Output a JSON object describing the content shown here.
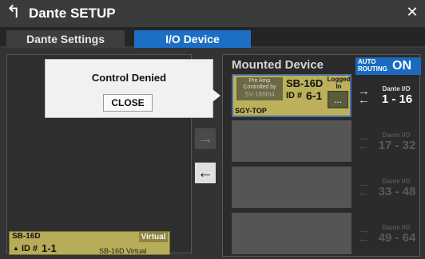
{
  "header": {
    "title": "Dante SETUP"
  },
  "tabs": [
    {
      "label": "Dante Settings"
    },
    {
      "label": "I/O Device"
    }
  ],
  "virtual_device": {
    "model": "SB-16D",
    "tag": "Virtual",
    "id_label": "ID #",
    "id": "1-1",
    "model_desc": "SB-16D Virtual"
  },
  "popup": {
    "message": "Control Denied",
    "button": "CLOSE"
  },
  "mounted": {
    "title": "Mounted Device",
    "auto_routing": {
      "label": "AUTO ROUTING",
      "state": "ON"
    },
    "device": {
      "preamp_line1": "Pre Amp",
      "preamp_line2": "Controlled by",
      "preamp_id": "SV-186fd4",
      "model": "SB-16D",
      "id_label": "ID #",
      "id": "6-1",
      "logged": "Logged In",
      "more": "...",
      "name": "SGY-TOP"
    },
    "slots": [
      {
        "dio_label": "Dante I/O",
        "range": "1 - 16",
        "active": true
      },
      {
        "dio_label": "Dante I/O",
        "range": "17 - 32",
        "active": false
      },
      {
        "dio_label": "Dante I/O",
        "range": "33 - 48",
        "active": false
      },
      {
        "dio_label": "Dante I/O",
        "range": "49 - 64",
        "active": false
      }
    ]
  },
  "colors": {
    "accent": "#1c6fc4",
    "device_card": "#bcb15a",
    "virtual_card": "#b7ac58"
  },
  "icons": {
    "back": "back-arrow-icon",
    "close": "close-icon",
    "move_right": "arrow-right-icon",
    "move_left": "arrow-left-icon",
    "transfer": "transfer-arrows-icon"
  }
}
